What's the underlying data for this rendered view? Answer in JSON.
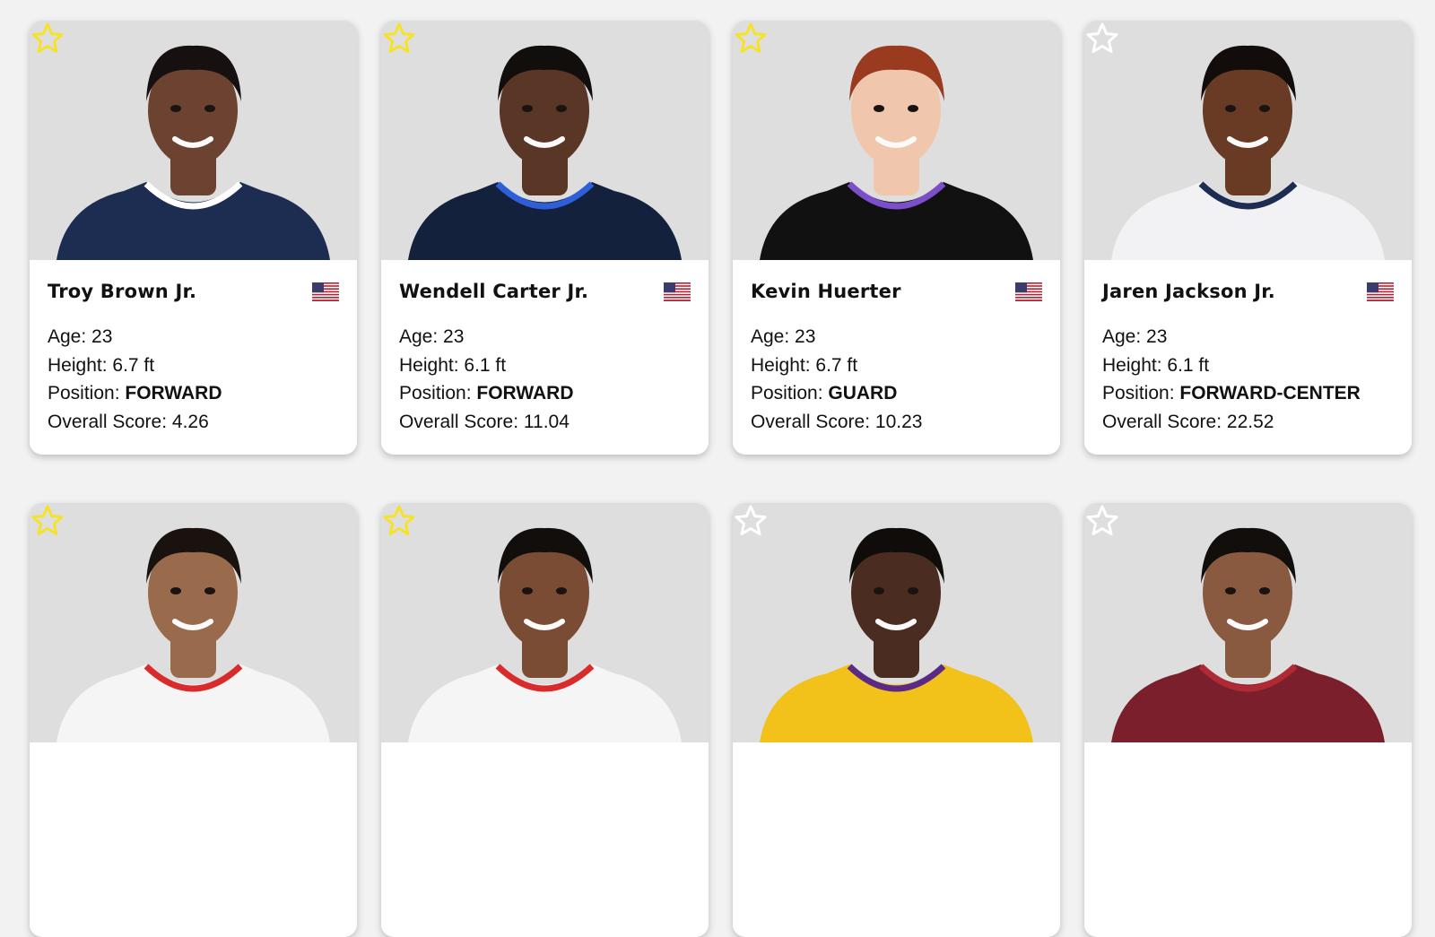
{
  "colors": {
    "page_bg": "#f2f2f2",
    "photo_bg": "#dedede",
    "star_active": "#f5e22a",
    "star_inactive": "#ffffff"
  },
  "labels": {
    "age": "Age:",
    "height": "Height:",
    "position": "Position:",
    "score": "Overall Score:"
  },
  "players": [
    {
      "name": "Troy Brown Jr.",
      "age": "23",
      "height": "6.7 ft",
      "position": "FORWARD",
      "score": "4.26",
      "favorite": true,
      "flag_icon": "us-flag-icon",
      "skin": "#6b4330",
      "hair": "#161010",
      "jersey": "#1d2d52",
      "trim": "#ffffff"
    },
    {
      "name": "Wendell Carter Jr.",
      "age": "23",
      "height": "6.1 ft",
      "position": "FORWARD",
      "score": "11.04",
      "favorite": true,
      "flag_icon": "us-flag-icon",
      "skin": "#5a3626",
      "hair": "#120e0c",
      "jersey": "#14213d",
      "trim": "#2f5fd6"
    },
    {
      "name": "Kevin Huerter",
      "age": "23",
      "height": "6.7 ft",
      "position": "GUARD",
      "score": "10.23",
      "favorite": true,
      "flag_icon": "us-flag-icon",
      "skin": "#f0c7ad",
      "hair": "#9a3b1f",
      "jersey": "#111111",
      "trim": "#7b4fc9"
    },
    {
      "name": "Jaren Jackson Jr.",
      "age": "23",
      "height": "6.1 ft",
      "position": "FORWARD-CENTER",
      "score": "22.52",
      "favorite": false,
      "flag_icon": "us-flag-icon",
      "skin": "#6a3b24",
      "hair": "#120c0a",
      "jersey": "#f2f2f4",
      "trim": "#1d2d52"
    },
    {
      "name": "",
      "age": "",
      "height": "",
      "position": "",
      "score": "",
      "favorite": true,
      "flag_icon": "",
      "skin": "#9a6a4c",
      "hair": "#1a120e",
      "jersey": "#f5f5f5",
      "trim": "#d92b2b"
    },
    {
      "name": "",
      "age": "",
      "height": "",
      "position": "",
      "score": "",
      "favorite": true,
      "flag_icon": "",
      "skin": "#7a4c34",
      "hair": "#120e0c",
      "jersey": "#f5f5f5",
      "trim": "#d92b2b"
    },
    {
      "name": "",
      "age": "",
      "height": "",
      "position": "",
      "score": "",
      "favorite": false,
      "flag_icon": "",
      "skin": "#4a2d20",
      "hair": "#0f0c0a",
      "jersey": "#f2c21b",
      "trim": "#5b2a86"
    },
    {
      "name": "",
      "age": "",
      "height": "",
      "position": "",
      "score": "",
      "favorite": false,
      "flag_icon": "",
      "skin": "#8a5a40",
      "hair": "#120e0c",
      "jersey": "#7a1f2b",
      "trim": "#b02a35"
    }
  ]
}
